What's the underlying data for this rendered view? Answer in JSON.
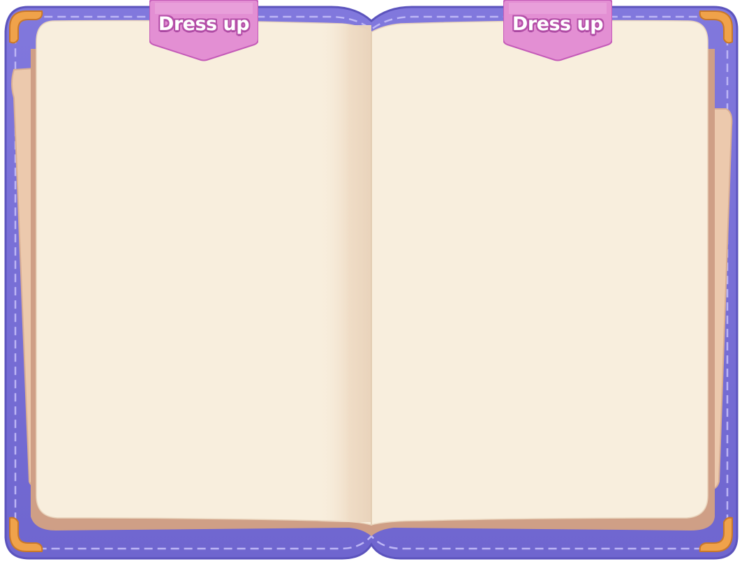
{
  "book": {
    "left_tab_label": "Dress up",
    "right_tab_label": "Dress up"
  },
  "colors": {
    "cover": "#7b72d6",
    "cover_dark": "#5e55c0",
    "stitch": "#b9b3f2",
    "page": "#f8eedd",
    "page_back": "#ecc9ad",
    "page_edge": "#d8a98f",
    "corner": "#f0a24a",
    "tab": "#e38fd3",
    "tab_outline": "#b44fa8"
  }
}
